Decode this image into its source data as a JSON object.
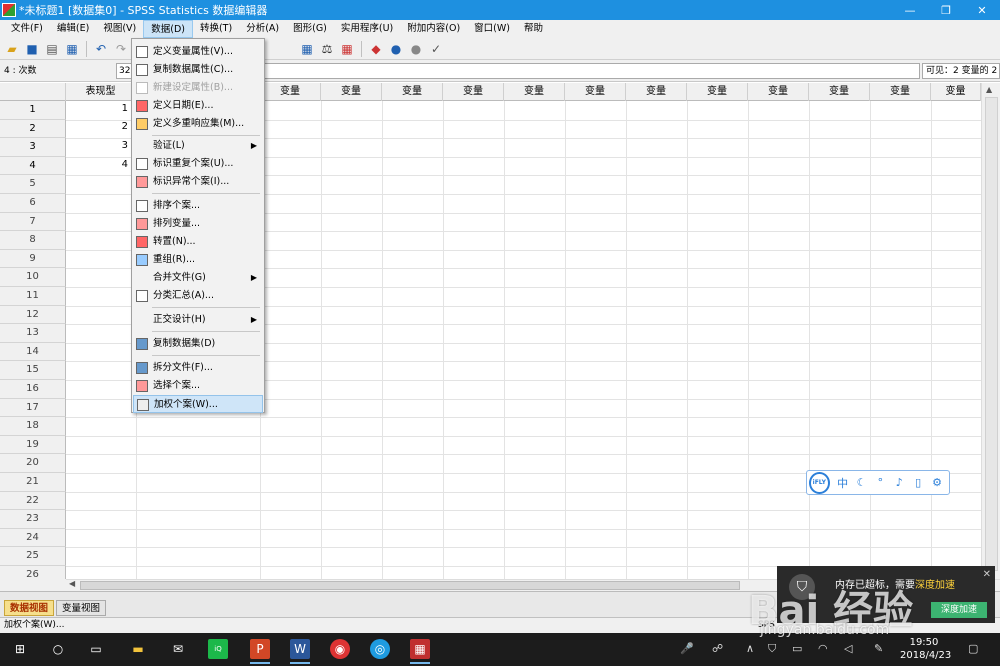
{
  "window": {
    "title": "*未标题1 [数据集0] - SPSS Statistics 数据编辑器",
    "minimize": "—",
    "restore": "❐",
    "close": "✕"
  },
  "menubar": [
    "文件(F)",
    "编辑(E)",
    "视图(V)",
    "数据(D)",
    "转换(T)",
    "分析(A)",
    "图形(G)",
    "实用程序(U)",
    "附加内容(O)",
    "窗口(W)",
    "帮助"
  ],
  "active_menu": "数据(D)",
  "addressbar": {
    "cell_name": "4 : 次数",
    "cell_value": "32",
    "visible_text": "可见：2 变量的 2"
  },
  "grid": {
    "columns": [
      "表现型",
      "",
      "变量",
      "变量",
      "变量",
      "变量",
      "变量",
      "变量",
      "变量",
      "变量",
      "变量",
      "变量",
      "变量",
      "变量",
      "变量",
      "变量"
    ],
    "row_numbers": [
      "1",
      "2",
      "3",
      "4",
      "5",
      "6",
      "7",
      "8",
      "9",
      "10",
      "11",
      "12",
      "13",
      "14",
      "15",
      "16",
      "17",
      "18",
      "19",
      "20",
      "21",
      "22",
      "23",
      "24",
      "25",
      "26"
    ],
    "cells": [
      "1",
      "2",
      "3",
      "4"
    ]
  },
  "data_menu": [
    {
      "label": "定义变量属性(V)...",
      "type": "item"
    },
    {
      "label": "复制数据属性(C)...",
      "type": "item"
    },
    {
      "label": "新建设定属性(B)...",
      "type": "disabled"
    },
    {
      "label": "定义日期(E)...",
      "type": "item"
    },
    {
      "label": "定义多重响应集(M)...",
      "type": "item"
    },
    {
      "label": "验证(L)",
      "type": "submenu"
    },
    {
      "label": "标识重复个案(U)...",
      "type": "item"
    },
    {
      "label": "标识异常个案(I)...",
      "type": "item"
    },
    {
      "label": "排序个案...",
      "type": "item"
    },
    {
      "label": "排列变量...",
      "type": "item"
    },
    {
      "label": "转置(N)...",
      "type": "item"
    },
    {
      "label": "重组(R)...",
      "type": "item"
    },
    {
      "label": "合并文件(G)",
      "type": "submenu"
    },
    {
      "label": "分类汇总(A)...",
      "type": "item"
    },
    {
      "label": "正交设计(H)",
      "type": "submenu"
    },
    {
      "label": "复制数据集(D)",
      "type": "item"
    },
    {
      "label": "拆分文件(F)...",
      "type": "item"
    },
    {
      "label": "选择个案...",
      "type": "item"
    },
    {
      "label": "加权个案(W)...",
      "type": "highlight"
    }
  ],
  "tabs": [
    "数据视图",
    "变量视图"
  ],
  "status": {
    "left": "加权个案(W)...",
    "right": "SPS"
  },
  "clock": {
    "time": "19:50",
    "date": "2018/4/23"
  },
  "ifly": {
    "logo": "iFLY",
    "lang": "中"
  },
  "popup": {
    "text_prefix": "内存已超标，需要",
    "text_highlight": "深度加速",
    "button": "深度加速"
  },
  "watermark": {
    "main": "Bai 经验",
    "sub": "jingyan.baidu.com"
  },
  "colors": {
    "titlebar": "#1E90E0",
    "active_tab": "#f6df8c",
    "menu_highlight": "#cfe5f8"
  },
  "taskbar_icons": [
    "windows-icon",
    "cortana-icon",
    "task-view-icon",
    "file-explorer-icon",
    "mail-icon",
    "iqiyi-icon",
    "powerpoint-icon",
    "word-icon",
    "netease-music-icon",
    "360-icon",
    "spss-icon"
  ]
}
